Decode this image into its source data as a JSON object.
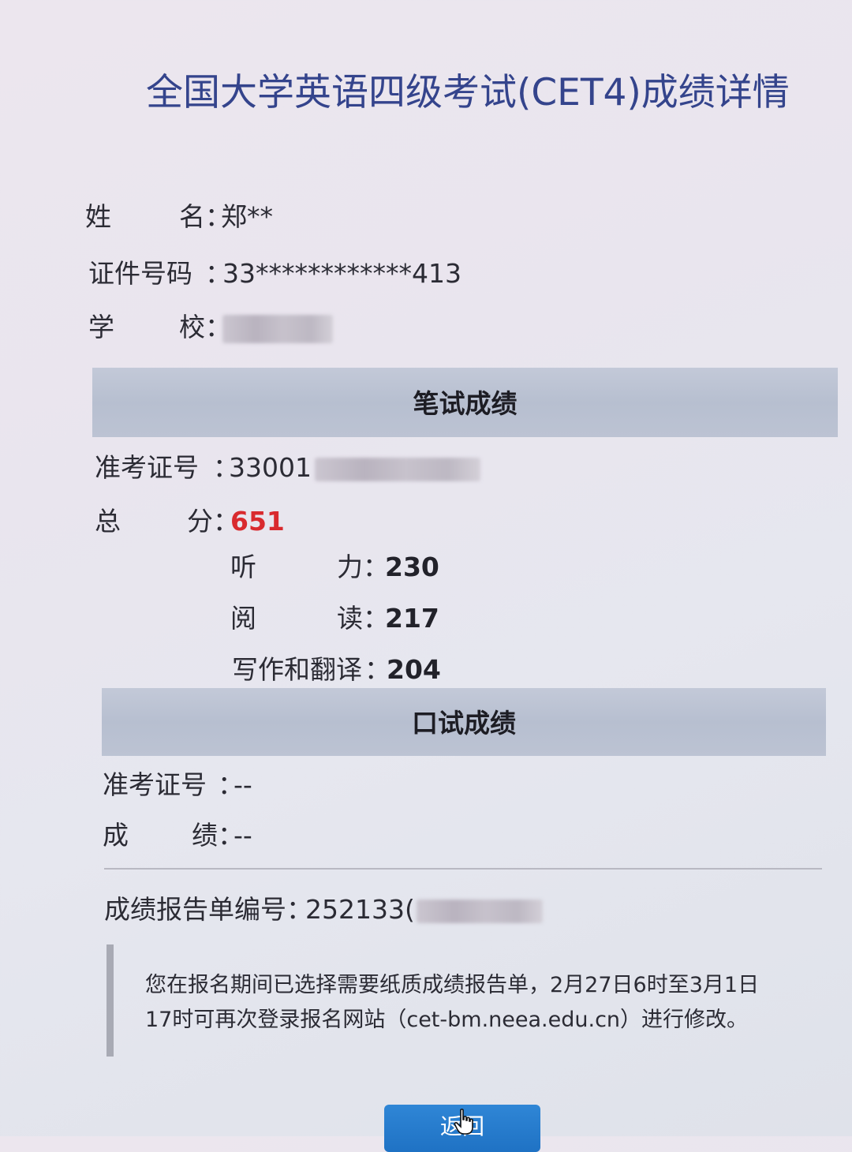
{
  "title": "全国大学英语四级考试(CET4)成绩详情",
  "candidate": {
    "name_label_1": "姓",
    "name_label_2": "名",
    "name_value": "郑**",
    "id_label": "证件号码",
    "id_value": "33************413",
    "school_label_1": "学",
    "school_label_2": "校",
    "school_value": "",
    "colon": "："
  },
  "written": {
    "header": "笔试成绩",
    "ticket_label": "准考证号",
    "ticket_value": "33001",
    "total_label_1": "总",
    "total_label_2": "分",
    "total_value": "651",
    "listening_label_1": "听",
    "listening_label_2": "力",
    "listening_value": "230",
    "reading_label_1": "阅",
    "reading_label_2": "读",
    "reading_value": "217",
    "writing_label": "写作和翻译",
    "writing_value": "204"
  },
  "oral": {
    "header": "口试成绩",
    "ticket_label": "准考证号",
    "ticket_value": "--",
    "score_label_1": "成",
    "score_label_2": "绩",
    "score_value": "--"
  },
  "report": {
    "label": "成绩报告单编号",
    "value": "252133("
  },
  "notice": {
    "text": "您在报名期间已选择需要纸质成绩报告单，2月27日6时至3月1日\n17时可再次登录报名网站（cet-bm.neea.edu.cn）进行修改。"
  },
  "button": {
    "label": "返回"
  },
  "colors": {
    "title": "#34448c",
    "total_score": "#d92a2e",
    "section_bar": "#b9c0d1",
    "button": "#2479c9"
  }
}
